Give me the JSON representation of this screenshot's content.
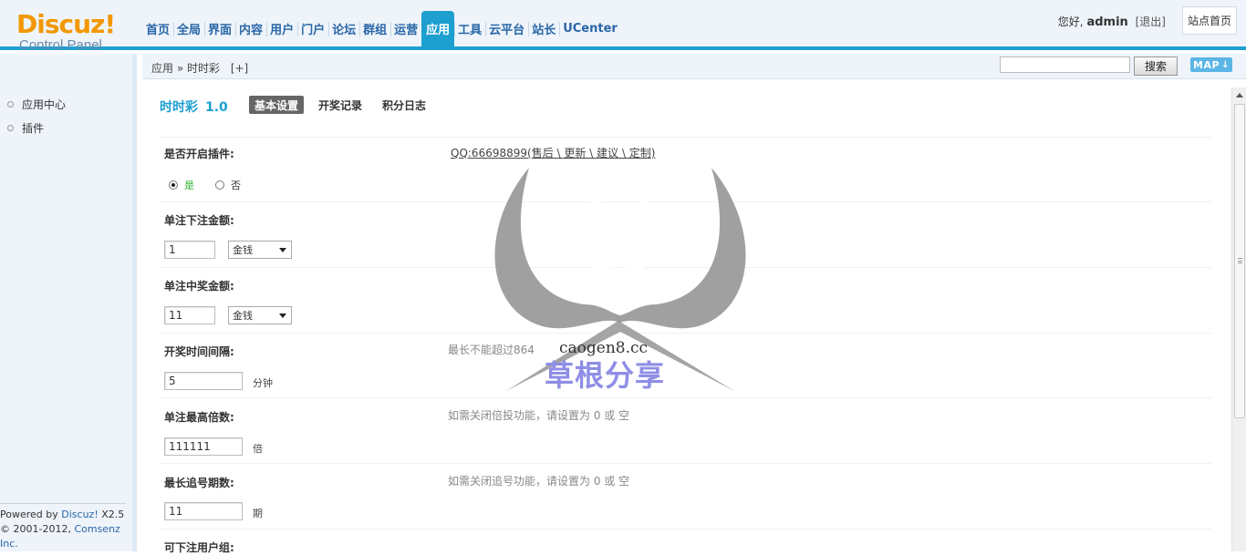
{
  "header": {
    "logo": {
      "brand": "Discuz!",
      "sub": "Control Panel"
    },
    "nav": [
      "首页",
      "全局",
      "界面",
      "内容",
      "用户",
      "门户",
      "论坛",
      "群组",
      "运营",
      "应用",
      "工具",
      "云平台",
      "站长",
      "UCenter"
    ],
    "nav_active_index": 9,
    "user": {
      "greeting": "您好,",
      "name": "admin",
      "logout": "[退出]"
    },
    "site_home": "站点首页"
  },
  "subbar": {
    "crumb": "应用 » 时时彩",
    "crumb_plus": "[+]",
    "search_value": "",
    "search_button": "搜索",
    "map_button": "MAP"
  },
  "sidebar": {
    "items": [
      "应用中心",
      "插件"
    ],
    "footer_powered": "Powered by",
    "footer_brand": "Discuz!",
    "footer_version": "X2.5",
    "footer_copyright": "© 2001-2012,",
    "footer_company": "Comsenz Inc."
  },
  "main": {
    "app_name": "时时彩",
    "app_version": "1.0",
    "tabs": [
      "基本设置",
      "开奖记录",
      "积分日志"
    ],
    "active_tab": 0,
    "qq_link": "QQ:66698899(售后 \\ 更新 \\ 建议 \\ 定制)",
    "fields": {
      "enable": {
        "label": "是否开启插件:",
        "yes": "是",
        "no": "否",
        "value": "是"
      },
      "bet_amount": {
        "label": "单注下注金额:",
        "value": "1",
        "currency": "金钱"
      },
      "win_amount": {
        "label": "单注中奖金额:",
        "value": "11",
        "currency": "金钱"
      },
      "interval": {
        "label": "开奖时间间隔:",
        "value": "5",
        "unit": "分钟",
        "tip": "最长不能超过864"
      },
      "max_multiple": {
        "label": "单注最高倍数:",
        "value": "111111",
        "unit": "倍",
        "tip": "如需关闭倍投功能，请设置为 0 或 空"
      },
      "max_periods": {
        "label": "最长追号期数:",
        "value": "11",
        "unit": "期",
        "tip": "如需关闭追号功能，请设置为 0 或 空"
      },
      "groups": {
        "label": "可下注用户组:"
      }
    }
  },
  "watermark": {
    "site": "caogen8.cc",
    "text": "草根分享",
    "letter": "S"
  },
  "colors": {
    "accent": "#1d9fd0",
    "logo": "#f39800",
    "nav_text": "#2966a7",
    "watermark": "#8e8ee6"
  }
}
